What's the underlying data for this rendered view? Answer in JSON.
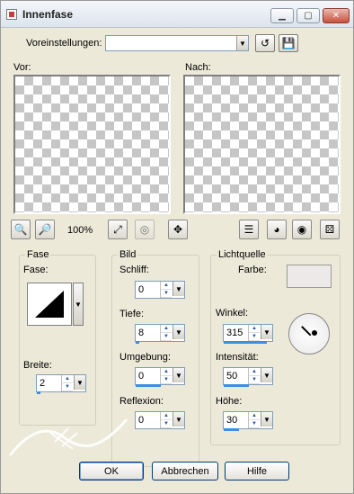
{
  "window": {
    "title": "Innenfase",
    "minimize_icon": "minimize-icon",
    "maximize_icon": "maximize-icon",
    "close_icon": "close-icon"
  },
  "presets": {
    "label": "Voreinstellungen:",
    "value": ""
  },
  "previews": {
    "before_label": "Vor:",
    "after_label": "Nach:"
  },
  "toolbar": {
    "zoom_out_icon": "zoom-out-icon",
    "zoom_in_icon": "zoom-in-icon",
    "zoom_level": "100%",
    "fit_icon": "fit-window-icon",
    "zoom_actual_icon": "zoom-actual-icon",
    "move_icon": "move-icon",
    "view_icons": [
      "panel-icon",
      "eye-light-icon",
      "eye-icon",
      "dice-icon"
    ]
  },
  "fase_group": {
    "title": "Fase",
    "fase_label": "Fase:",
    "breite_label": "Breite:",
    "breite_value": "2"
  },
  "bild_group": {
    "title": "Bild",
    "schliff_label": "Schliff:",
    "schliff_value": "0",
    "tiefe_label": "Tiefe:",
    "tiefe_value": "8",
    "umgebung_label": "Umgebung:",
    "umgebung_value": "0",
    "reflexion_label": "Reflexion:",
    "reflexion_value": "0"
  },
  "light_group": {
    "title": "Lichtquelle",
    "farbe_label": "Farbe:",
    "farbe_color": "#eee9e9",
    "winkel_label": "Winkel:",
    "winkel_value": "315",
    "intensitaet_label": "Intensität:",
    "intensitaet_value": "50",
    "hoehe_label": "Höhe:",
    "hoehe_value": "30"
  },
  "buttons": {
    "ok": "OK",
    "cancel": "Abbrechen",
    "help": "Hilfe"
  }
}
